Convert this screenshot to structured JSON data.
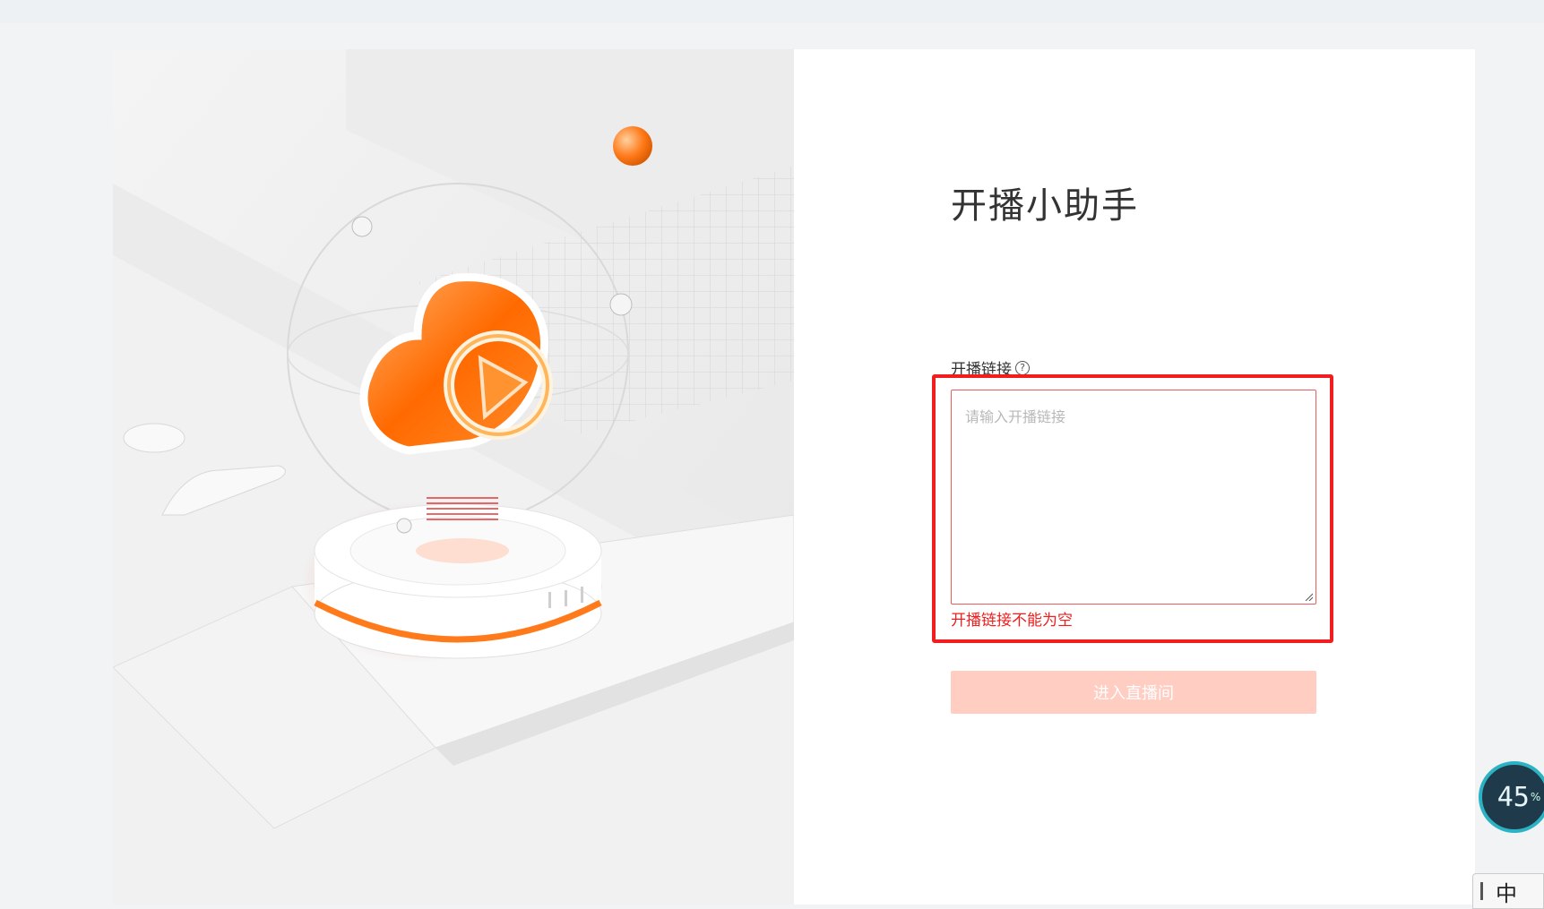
{
  "app": {
    "title": "开播小助手"
  },
  "form": {
    "link_label": "开播链接",
    "help_icon": "?",
    "link_placeholder": "请输入开播链接",
    "link_value": "",
    "error_message": "开播链接不能为空",
    "submit_label": "进入直播间"
  },
  "widgets": {
    "progress_value": "45",
    "progress_unit": "%",
    "ime_mode": "中"
  },
  "colors": {
    "accent": "#ff6a00",
    "error": "#f01e1e",
    "button_disabled": "#ffcdc2"
  }
}
